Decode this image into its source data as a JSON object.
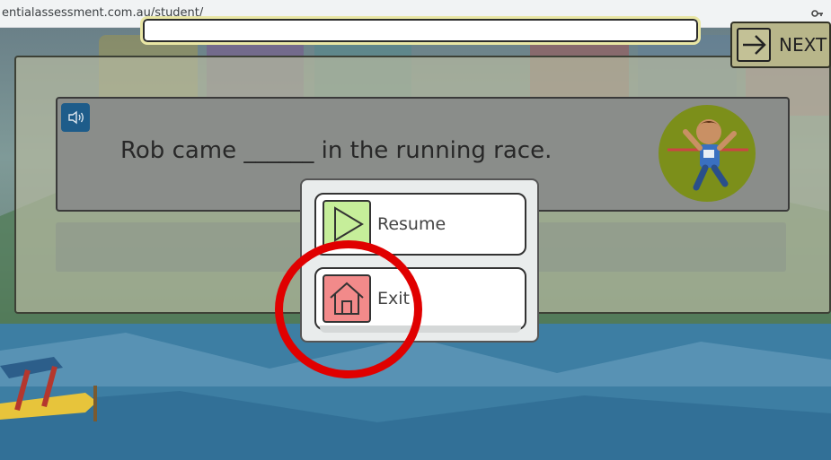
{
  "browser": {
    "url": "entialassessment.com.au/student/",
    "key_icon": "key-icon"
  },
  "activity": {
    "answer_value": "",
    "next_label": "NEXT",
    "sound_icon": "speaker-icon",
    "question": "Rob came ______ in the running race.",
    "illustration": "runner-crossing-finish-line"
  },
  "pause_menu": {
    "items": [
      {
        "label": "Resume",
        "icon": "play-icon",
        "color": "#c6ee9a"
      },
      {
        "label": "Exit",
        "icon": "home-icon",
        "color": "#f28a8a"
      }
    ]
  },
  "annotation": {
    "highlight_color": "#e00000"
  }
}
